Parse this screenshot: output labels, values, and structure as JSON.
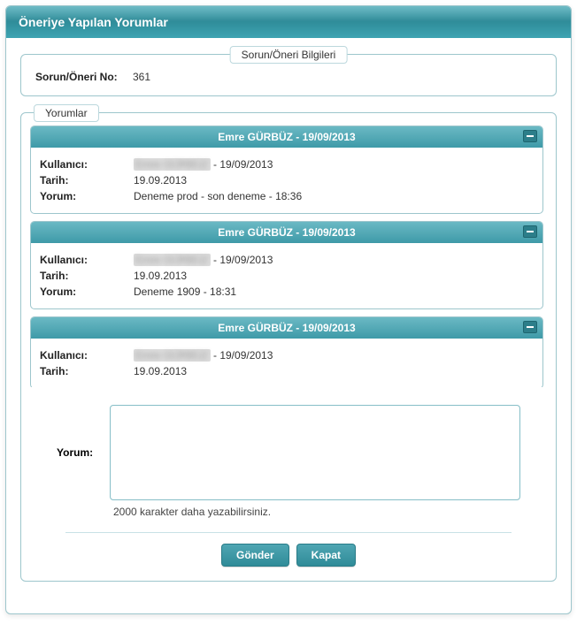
{
  "window": {
    "title": "Öneriye Yapılan Yorumlar"
  },
  "infoBox": {
    "legend": "Sorun/Öneri Bilgileri",
    "noLabel": "Sorun/Öneri No:",
    "noValue": "361"
  },
  "commentsBox": {
    "legend": "Yorumlar",
    "labels": {
      "user": "Kullanıcı:",
      "date": "Tarih:",
      "comment": "Yorum:"
    },
    "items": [
      {
        "header": "Emre GÜRBÜZ - 19/09/2013",
        "userBlurred": "Emre GÜRBÜZ",
        "userDate": " - 19/09/2013",
        "date": "19.09.2013",
        "comment": "Deneme prod - son deneme - 18:36"
      },
      {
        "header": "Emre GÜRBÜZ - 19/09/2013",
        "userBlurred": "Emre GÜRBÜZ",
        "userDate": " - 19/09/2013",
        "date": "19.09.2013",
        "comment": "Deneme 1909 - 18:31"
      },
      {
        "header": "Emre GÜRBÜZ - 19/09/2013",
        "userBlurred": "Emre GÜRBÜZ",
        "userDate": " - 19/09/2013",
        "date": "19.09.2013",
        "comment": ""
      }
    ]
  },
  "compose": {
    "label": "Yorum:",
    "value": "",
    "hint": "2000 karakter daha yazabilirsiniz."
  },
  "buttons": {
    "send": "Gönder",
    "close": "Kapat"
  }
}
